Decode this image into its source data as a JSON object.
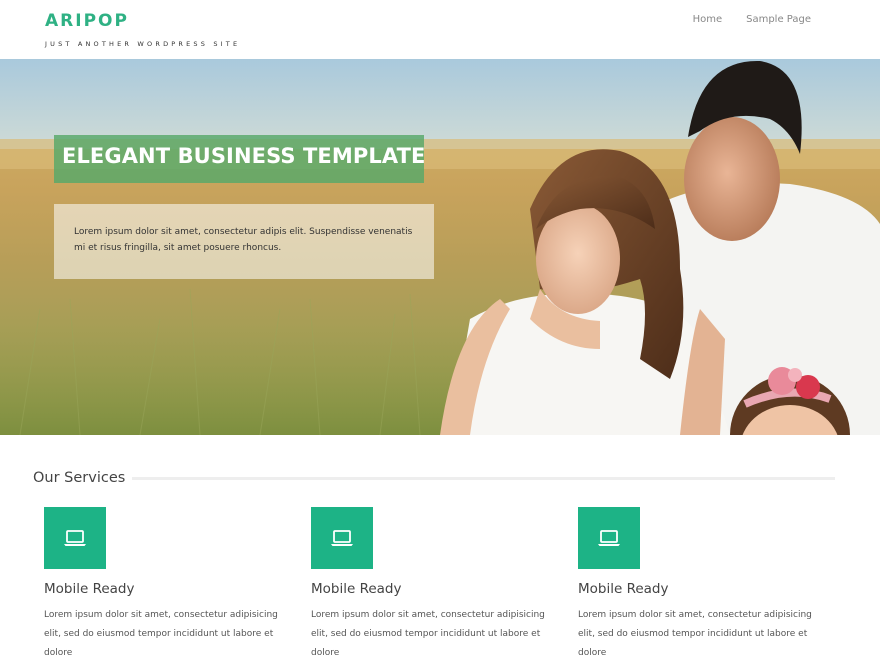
{
  "site": {
    "title": "ARIPOP",
    "tagline": "JUST ANOTHER WORDPRESS SITE"
  },
  "nav": {
    "items": [
      {
        "label": "Home"
      },
      {
        "label": "Sample Page"
      }
    ]
  },
  "hero": {
    "title": "ELEGANT BUSINESS TEMPLATE",
    "text": "Lorem ipsum dolor sit amet, consectetur adipis elit. Suspendisse venenatis mi et risus fringilla, sit amet posuere rhoncus."
  },
  "services": {
    "heading": "Our Services",
    "items": [
      {
        "icon": "laptop-icon",
        "title": "Mobile Ready",
        "text": "Lorem ipsum dolor sit amet, consectetur adipisicing elit, sed do eiusmod tempor incididunt ut labore et dolore"
      },
      {
        "icon": "laptop-icon",
        "title": "Mobile Ready",
        "text": "Lorem ipsum dolor sit amet, consectetur adipisicing elit, sed do eiusmod tempor incididunt ut labore et dolore"
      },
      {
        "icon": "laptop-icon",
        "title": "Mobile Ready",
        "text": "Lorem ipsum dolor sit amet, consectetur adipisicing elit, sed do eiusmod tempor incididunt ut labore et dolore"
      }
    ]
  },
  "colors": {
    "brand": "#2fb184",
    "icon_box": "#1db386",
    "hero_title_bg": "#57a869"
  }
}
